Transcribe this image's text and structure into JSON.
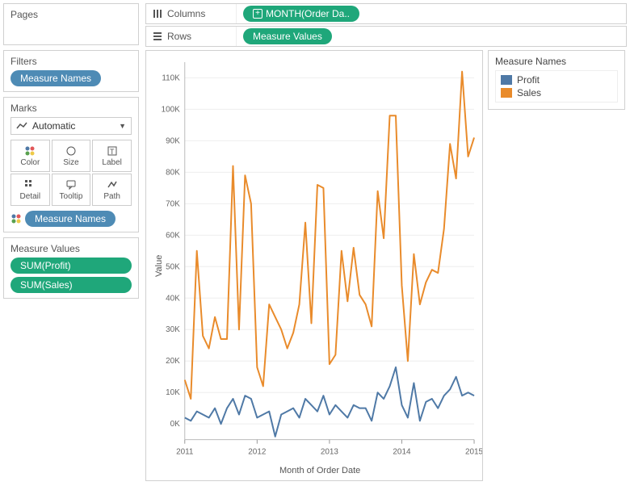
{
  "left": {
    "pages_title": "Pages",
    "filters_title": "Filters",
    "filters_pill": "Measure Names",
    "marks_title": "Marks",
    "marks_dropdown": "Automatic",
    "marks_buttons": [
      "Color",
      "Size",
      "Label",
      "Detail",
      "Tooltip",
      "Path"
    ],
    "marks_pill": "Measure Names",
    "mv_title": "Measure Values",
    "mv_pills": [
      "SUM(Profit)",
      "SUM(Sales)"
    ]
  },
  "shelves": {
    "columns_label": "Columns",
    "columns_pill": "MONTH(Order Da..",
    "rows_label": "Rows",
    "rows_pill": "Measure Values"
  },
  "legend": {
    "title": "Measure Names",
    "items": [
      {
        "label": "Profit",
        "color": "#4f79a6"
      },
      {
        "label": "Sales",
        "color": "#e98b2b"
      }
    ]
  },
  "chart_data": {
    "type": "line",
    "xlabel": "Month of Order Date",
    "ylabel": "Value",
    "ylim": [
      -5000,
      115000
    ],
    "y_ticks": [
      0,
      10000,
      20000,
      30000,
      40000,
      50000,
      60000,
      70000,
      80000,
      90000,
      100000,
      110000
    ],
    "y_tick_labels": [
      "0K",
      "10K",
      "20K",
      "30K",
      "40K",
      "50K",
      "60K",
      "70K",
      "80K",
      "90K",
      "100K",
      "110K"
    ],
    "x_tick_labels": [
      "2011",
      "2012",
      "2013",
      "2014",
      "2015"
    ],
    "x_tick_index": [
      0,
      12,
      24,
      36,
      48
    ],
    "n_points": 49,
    "series": [
      {
        "name": "Sales",
        "color": "#e98b2b",
        "values": [
          14000,
          8000,
          55000,
          28000,
          24000,
          34000,
          27000,
          27000,
          82000,
          30000,
          79000,
          70000,
          18000,
          12000,
          38000,
          34000,
          30000,
          24000,
          29000,
          38000,
          64000,
          32000,
          76000,
          75000,
          19000,
          22000,
          55000,
          39000,
          56000,
          41000,
          38000,
          31000,
          74000,
          59000,
          98000,
          98000,
          44000,
          20000,
          54000,
          38000,
          45000,
          49000,
          48000,
          62000,
          89000,
          78000,
          112000,
          85000,
          91000
        ]
      },
      {
        "name": "Profit",
        "color": "#4f79a6",
        "values": [
          2000,
          1000,
          4000,
          3000,
          2000,
          5000,
          0,
          5000,
          8000,
          3000,
          9000,
          8000,
          2000,
          3000,
          4000,
          -4000,
          3000,
          4000,
          5000,
          2000,
          8000,
          6000,
          4000,
          9000,
          3000,
          6000,
          4000,
          2000,
          6000,
          5000,
          5000,
          1000,
          10000,
          8000,
          12000,
          18000,
          6000,
          2000,
          13000,
          1000,
          7000,
          8000,
          5000,
          9000,
          11000,
          15000,
          9000,
          10000,
          9000
        ]
      }
    ]
  }
}
